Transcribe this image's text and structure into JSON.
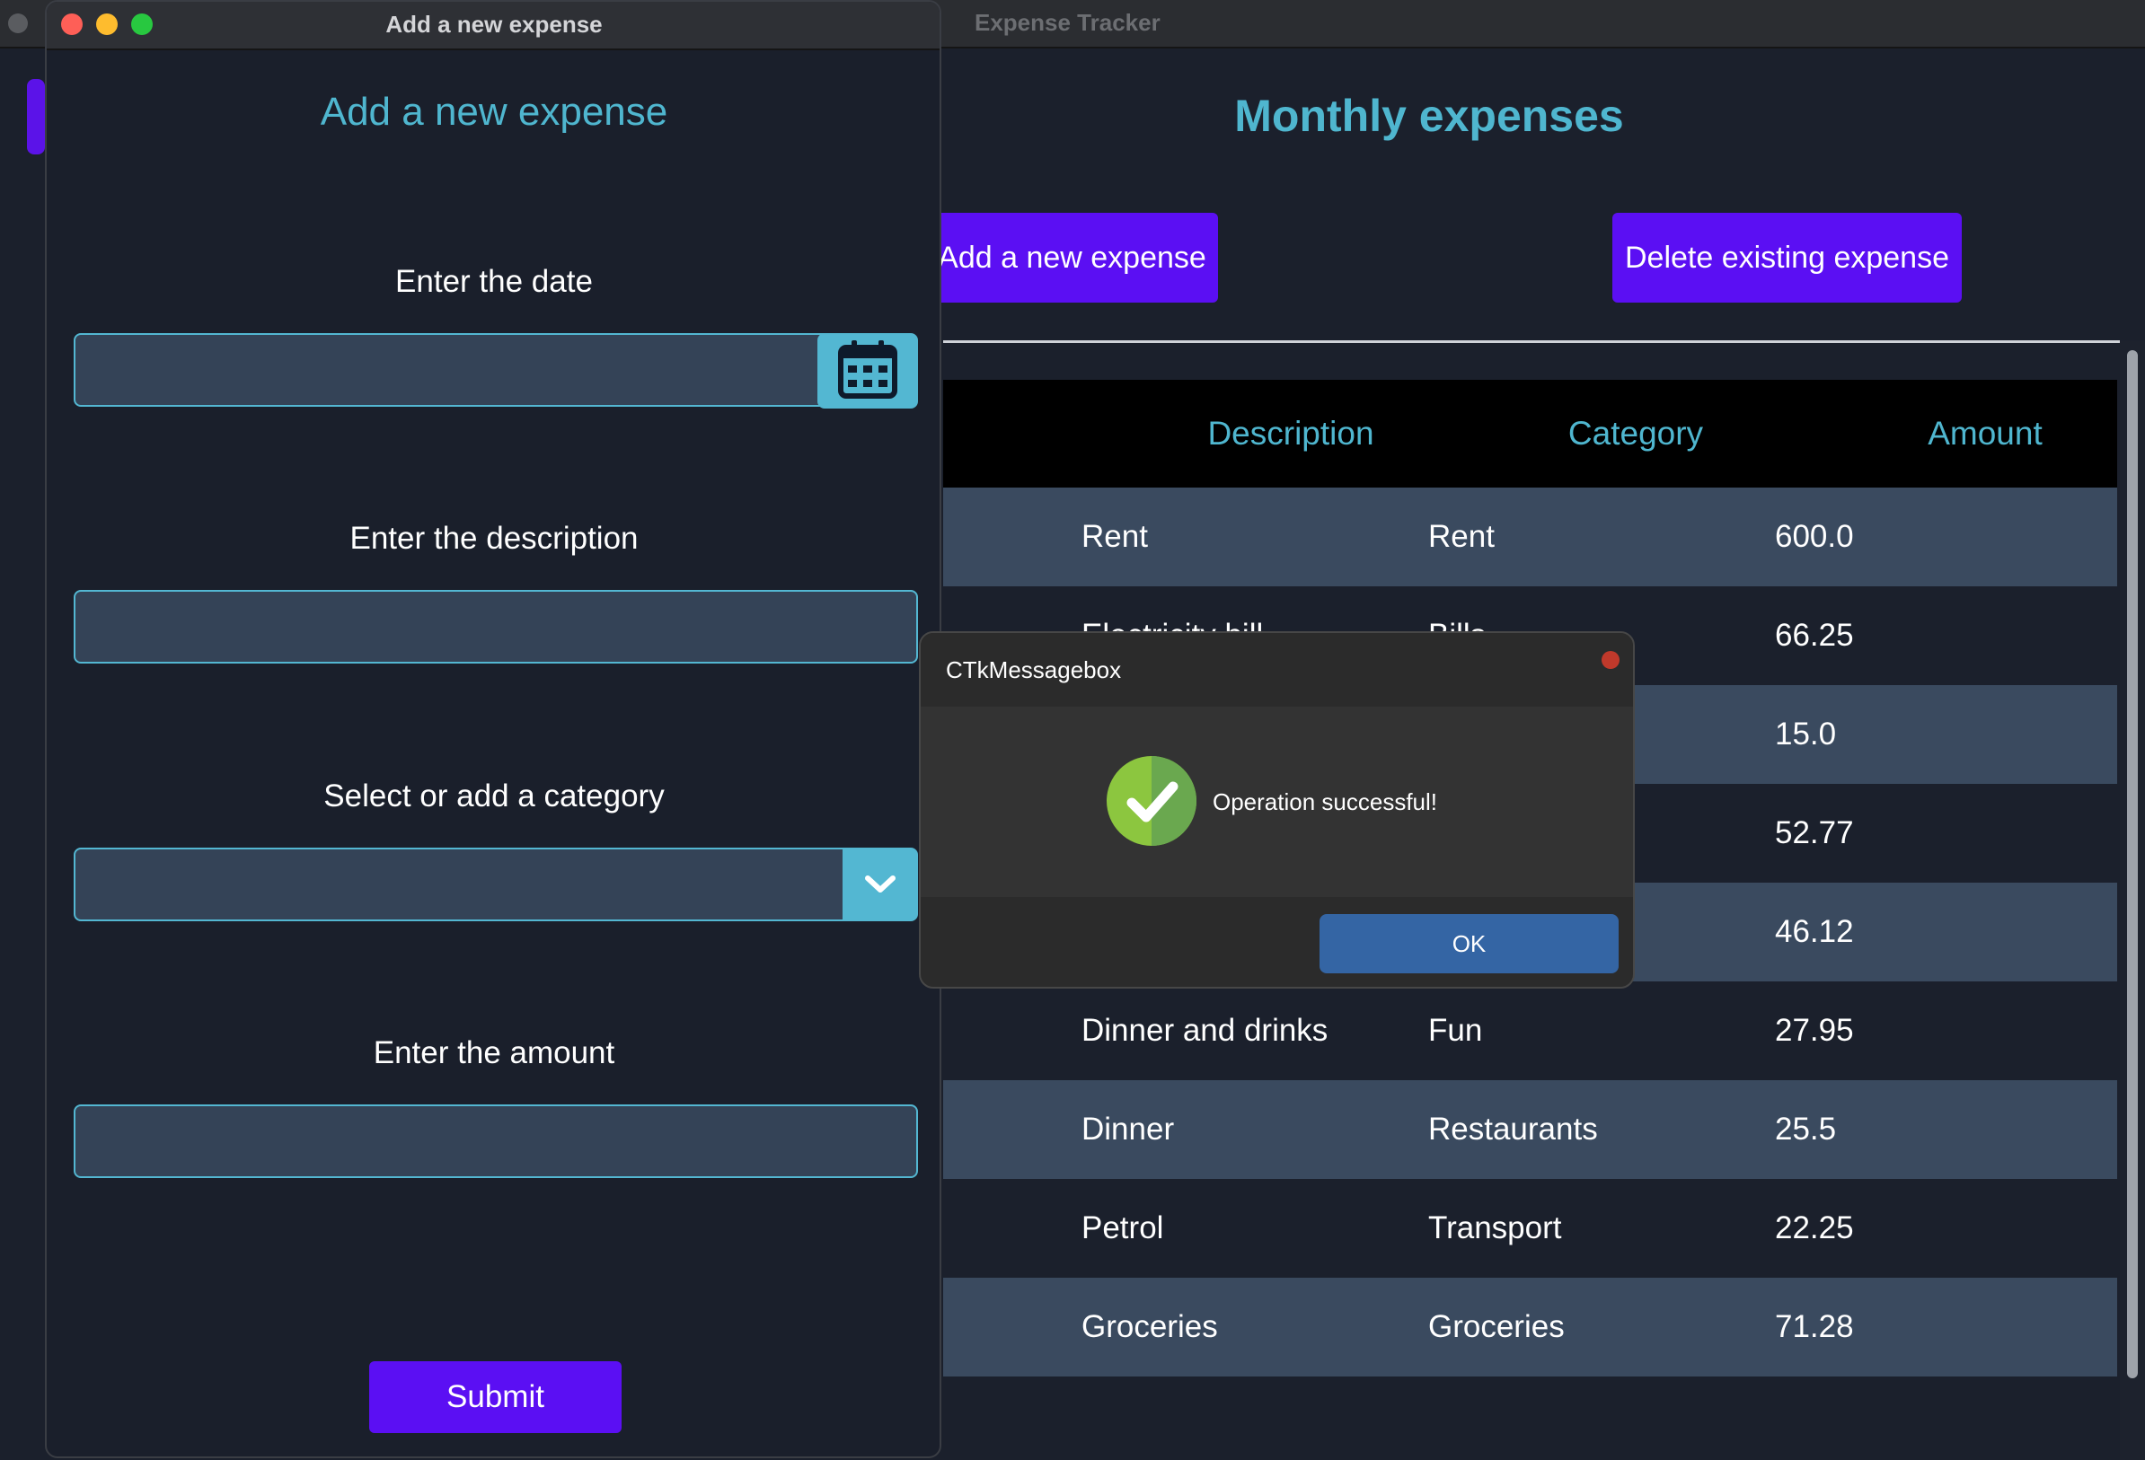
{
  "main_window": {
    "title": "Expense Tracker",
    "heading": "Monthly expenses",
    "add_button": "Add a new expense",
    "delete_button": "Delete existing expense",
    "table": {
      "columns": [
        "Description",
        "Category",
        "Amount"
      ],
      "rows": [
        {
          "description": "Rent",
          "category": "Rent",
          "amount": "600.0"
        },
        {
          "description": "Electricity bill",
          "category": "Bills",
          "amount": "66.25"
        },
        {
          "description": "",
          "category": "",
          "amount": "15.0"
        },
        {
          "description": "",
          "category": "",
          "amount": "52.77"
        },
        {
          "description": "",
          "category": "",
          "amount": "46.12"
        },
        {
          "description": "Dinner and drinks",
          "category": "Fun",
          "amount": "27.95"
        },
        {
          "description": "Dinner",
          "category": "Restaurants",
          "amount": "25.5"
        },
        {
          "description": "Petrol",
          "category": "Transport",
          "amount": "22.25"
        },
        {
          "description": "Groceries",
          "category": "Groceries",
          "amount": "71.28"
        }
      ]
    }
  },
  "add_window": {
    "title": "Add a new expense",
    "heading": "Add a new expense",
    "date_label": "Enter the date",
    "date_value": "",
    "description_label": "Enter the description",
    "description_value": "",
    "category_label": "Select or add a category",
    "category_value": "",
    "amount_label": "Enter the amount",
    "amount_value": "",
    "submit": "Submit"
  },
  "messagebox": {
    "title": "CTkMessagebox",
    "message": "Operation successful!",
    "ok": "OK",
    "icon": "check-icon"
  },
  "colors": {
    "accent_cyan": "#4fb6cf",
    "button_purple": "#5b0ff3",
    "row_alt": "#3a4a5f",
    "background": "#1b202c",
    "ok_blue": "#3465a4",
    "success_green": "#8cc63f"
  }
}
